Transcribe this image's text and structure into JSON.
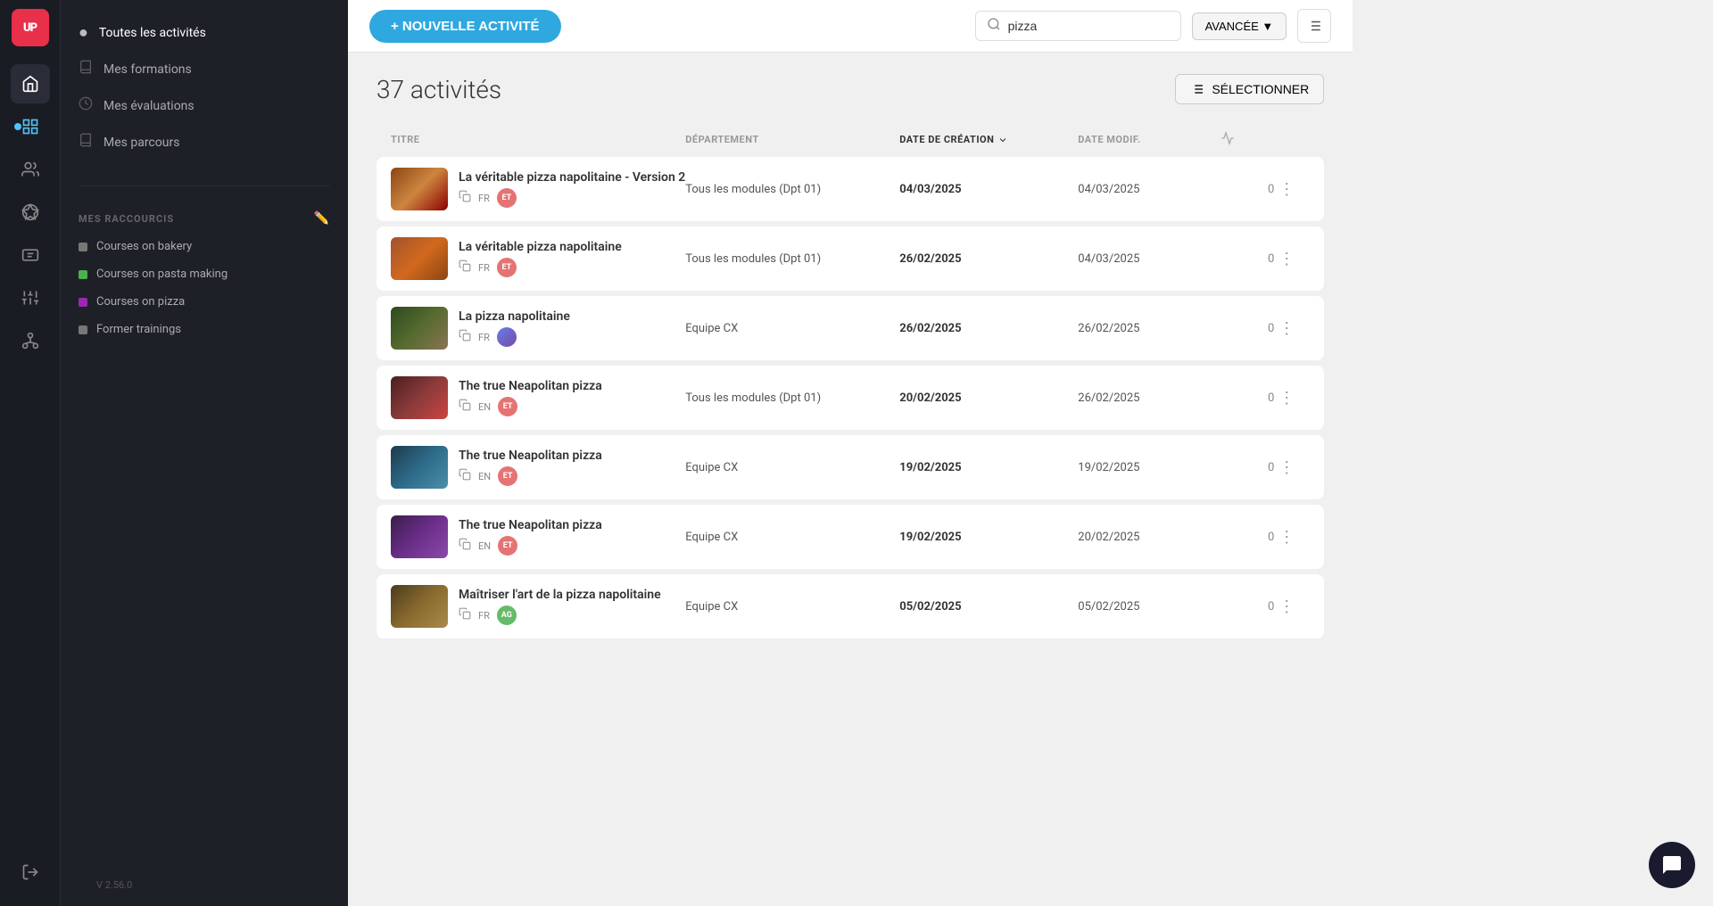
{
  "app": {
    "logo": "UP",
    "version": "V 2.56.0"
  },
  "sidebar": {
    "active_item": "Toutes les activités",
    "active_dot_color": "#4ec3f7",
    "nav_items": [
      {
        "id": "toutes-activites",
        "label": "Toutes les activités",
        "active": true
      },
      {
        "id": "mes-formations",
        "label": "Mes formations"
      },
      {
        "id": "mes-evaluations",
        "label": "Mes évaluations"
      },
      {
        "id": "mes-parcours",
        "label": "Mes parcours"
      }
    ],
    "shortcuts_label": "MES RACCOURCIS",
    "shortcuts": [
      {
        "id": "courses-bakery",
        "label": "Courses on bakery",
        "color": "gray"
      },
      {
        "id": "courses-pasta",
        "label": "Courses on pasta making",
        "color": "green"
      },
      {
        "id": "courses-pizza",
        "label": "Courses on pizza",
        "color": "purple"
      },
      {
        "id": "former-trainings",
        "label": "Former trainings",
        "color": "gray"
      }
    ]
  },
  "topbar": {
    "new_activity_btn": "+ NOUVELLE ACTIVITÉ",
    "search_placeholder": "pizza",
    "search_value": "pizza",
    "avancee_label": "AVANCÉE ▼"
  },
  "content": {
    "activity_count": "37 activités",
    "select_btn": "SÉLECTIONNER",
    "table_headers": {
      "titre": "TITRE",
      "departement": "DÉPARTEMENT",
      "date_creation": "DATE DE CRÉATION",
      "date_modif": "DATE MODIF."
    },
    "rows": [
      {
        "id": 1,
        "title": "La véritable pizza napolitaine - Version 2",
        "lang": "FR",
        "avatar": "ET",
        "departement": "Tous les modules (Dpt 01)",
        "date_creation": "04/03/2025",
        "date_modif": "04/03/2025",
        "stat": "0",
        "thumb": "thumb-pizza"
      },
      {
        "id": 2,
        "title": "La véritable pizza napolitaine",
        "lang": "FR",
        "avatar": "ET",
        "departement": "Tous les modules (Dpt 01)",
        "date_creation": "26/02/2025",
        "date_modif": "04/03/2025",
        "stat": "0",
        "thumb": "thumb-pizza2"
      },
      {
        "id": 3,
        "title": "La pizza napolitaine",
        "lang": "FR",
        "avatar": "photo",
        "departement": "Equipe CX",
        "date_creation": "26/02/2025",
        "date_modif": "26/02/2025",
        "stat": "0",
        "thumb": "thumb-pizza3"
      },
      {
        "id": 4,
        "title": "The true Neapolitan pizza",
        "lang": "EN",
        "avatar": "ET",
        "departement": "Tous les modules (Dpt 01)",
        "date_creation": "20/02/2025",
        "date_modif": "26/02/2025",
        "stat": "0",
        "thumb": "thumb-pizza4"
      },
      {
        "id": 5,
        "title": "The true Neapolitan pizza",
        "lang": "EN",
        "avatar": "ET",
        "departement": "Equipe CX",
        "date_creation": "19/02/2025",
        "date_modif": "19/02/2025",
        "stat": "0",
        "thumb": "thumb-pizza5"
      },
      {
        "id": 6,
        "title": "The true Neapolitan pizza",
        "lang": "EN",
        "avatar": "ET",
        "departement": "Equipe CX",
        "date_creation": "19/02/2025",
        "date_modif": "20/02/2025",
        "stat": "0",
        "thumb": "thumb-pizza6"
      },
      {
        "id": 7,
        "title": "Maîtriser l'art de la pizza napolitaine",
        "lang": "FR",
        "avatar": "AG",
        "departement": "Equipe CX",
        "date_creation": "05/02/2025",
        "date_modif": "05/02/2025",
        "stat": "0",
        "thumb": "thumb-pizza7"
      }
    ]
  }
}
